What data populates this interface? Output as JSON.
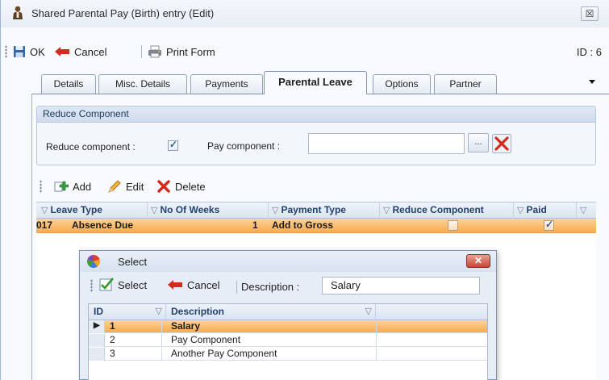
{
  "window": {
    "title": "Shared Parental Pay (Birth) entry (Edit)",
    "close_glyph": "☒"
  },
  "toolbar": {
    "ok_label": "OK",
    "cancel_label": "Cancel",
    "print_label": "Print Form",
    "id_label": "ID : 6"
  },
  "tabs": [
    {
      "label": "Details"
    },
    {
      "label": "Misc. Details"
    },
    {
      "label": "Payments"
    },
    {
      "label": "Parental Leave",
      "active": true
    },
    {
      "label": "Options"
    },
    {
      "label": "Partner"
    }
  ],
  "reduce_group": {
    "header": "Reduce Component",
    "reduce_label": "Reduce component :",
    "reduce_checked": true,
    "pay_component_label": "Pay component :",
    "pay_component_value": "",
    "browse_label": "..."
  },
  "grid_toolbar": {
    "add_label": "Add",
    "edit_label": "Edit",
    "delete_label": "Delete"
  },
  "grid": {
    "columns": [
      "Leave Type",
      "No Of Weeks",
      "Payment Type",
      "Reduce Component",
      "Paid"
    ],
    "rows": [
      {
        "date_fragment": "017",
        "leave_type": "Absence Due",
        "weeks": "1",
        "payment_type": "Add to Gross",
        "reduce": false,
        "paid": true
      }
    ]
  },
  "select_dialog": {
    "title": "Select",
    "select_label": "Select",
    "cancel_label": "Cancel",
    "description_label": "Description :",
    "search_value": "Salary",
    "columns": [
      "ID",
      "Description"
    ],
    "rows": [
      {
        "id": "1",
        "description": "Salary",
        "selected": true
      },
      {
        "id": "2",
        "description": "Pay Component"
      },
      {
        "id": "3",
        "description": "Another Pay Component"
      }
    ]
  },
  "colors": {
    "selection": "#f7ab4e",
    "accent": "#2a5fa6",
    "delete_red": "#d42a1c"
  }
}
